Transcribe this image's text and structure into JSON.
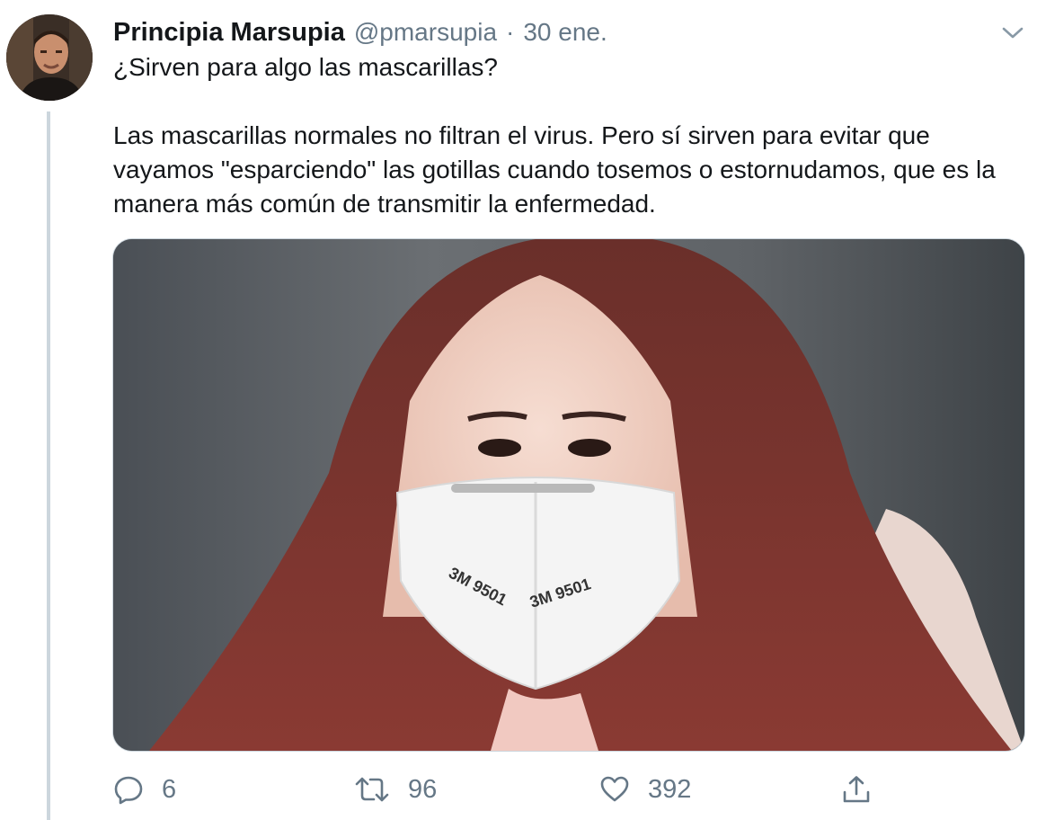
{
  "tweet": {
    "display_name": "Principia Marsupia",
    "handle": "@pmarsupia",
    "separator": "·",
    "timestamp": "30 ene.",
    "text_line1": "¿Sirven para algo las mascarillas?",
    "text_para2": "Las mascarillas normales no filtran el virus. Pero sí sirven para evitar que vayamos \"esparciendo\" las gotillas cuando tosemos o estornudamos, que es la manera más común de transmitir la enfermedad.",
    "media": {
      "mask_label_left": "3M 9501",
      "mask_label_right": "3M 9501"
    }
  },
  "actions": {
    "reply": {
      "icon": "reply-icon",
      "count": "6"
    },
    "retweet": {
      "icon": "retweet-icon",
      "count": "96"
    },
    "like": {
      "icon": "like-icon",
      "count": "392"
    },
    "share": {
      "icon": "share-icon"
    }
  },
  "colors": {
    "text": "#14171a",
    "secondary": "#657786",
    "thread_line": "#ccd6dd"
  }
}
